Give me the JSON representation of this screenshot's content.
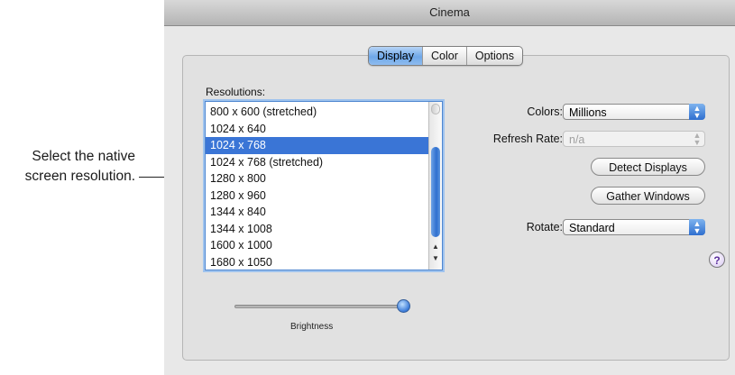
{
  "callout": {
    "line1": "Select the native",
    "line2": "screen resolution."
  },
  "window": {
    "title": "Cinema"
  },
  "tabs": [
    {
      "label": "Display",
      "active": true
    },
    {
      "label": "Color",
      "active": false
    },
    {
      "label": "Options",
      "active": false
    }
  ],
  "resolutions": {
    "label": "Resolutions:",
    "items": [
      "800 x 600 (stretched)",
      "1024 x 640",
      "1024 x 768",
      "1024 x 768 (stretched)",
      "1280 x 800",
      "1280 x 960",
      "1344 x 840",
      "1344 x 1008",
      "1600 x 1000",
      "1680 x 1050"
    ],
    "selected": "1024 x 768"
  },
  "colors": {
    "label": "Colors:",
    "value": "Millions"
  },
  "refresh": {
    "label": "Refresh Rate:",
    "value": "n/a"
  },
  "buttons": {
    "detect": "Detect Displays",
    "gather": "Gather Windows"
  },
  "rotate": {
    "label": "Rotate:",
    "value": "Standard"
  },
  "help": {
    "glyph": "?"
  },
  "brightness": {
    "label": "Brightness",
    "level": 1.0
  },
  "accent": "#3a75d6"
}
